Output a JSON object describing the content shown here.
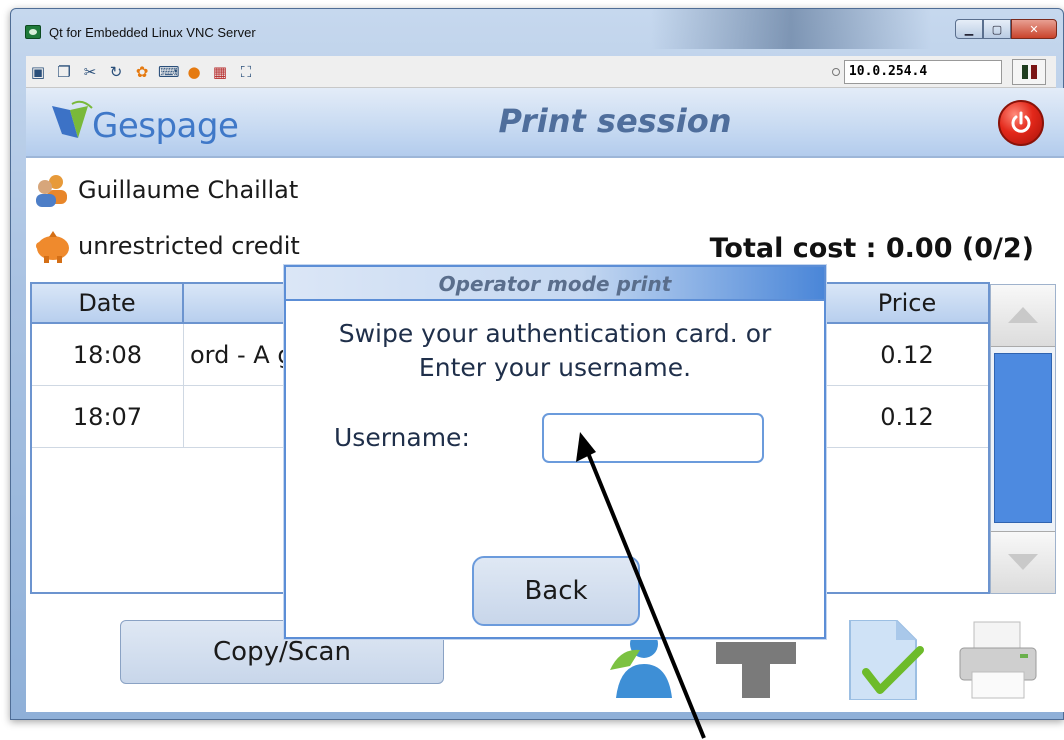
{
  "window": {
    "title": "Qt for Embedded Linux VNC Server",
    "controls": [
      "minimize",
      "maximize",
      "close"
    ]
  },
  "vnc_toolbar": {
    "icons": [
      "monitor-icon",
      "windows-icon",
      "tools-icon",
      "refresh-icon",
      "colors-icon",
      "keyboard-icon",
      "alert-icon",
      "network-icon",
      "fullscreen-icon"
    ],
    "host": "10.0.254.4"
  },
  "app": {
    "logo_text": "Gespage",
    "title": "Print session",
    "user_name": "Guillaume Chaillat",
    "credit": "unrestricted credit",
    "total_cost": "Total cost : 0.00  (0/2)"
  },
  "table": {
    "headers": [
      "Date",
      "",
      "Price"
    ],
    "rows": [
      {
        "date": "18:08",
        "doc": "ord - A g",
        "price": "0.12"
      },
      {
        "date": "18:07",
        "doc": "",
        "price": "0.12"
      }
    ]
  },
  "buttons": {
    "copy_scan": "Copy/Scan"
  },
  "dialog": {
    "title": "Operator mode print",
    "message_line1": "Swipe your authentication card. or",
    "message_line2": "Enter your username.",
    "username_label": "Username:",
    "username_value": "",
    "back_label": "Back"
  },
  "colors": {
    "accent": "#4d8ae0",
    "title_text": "#4f6e9c",
    "power_red": "#e3281a"
  }
}
